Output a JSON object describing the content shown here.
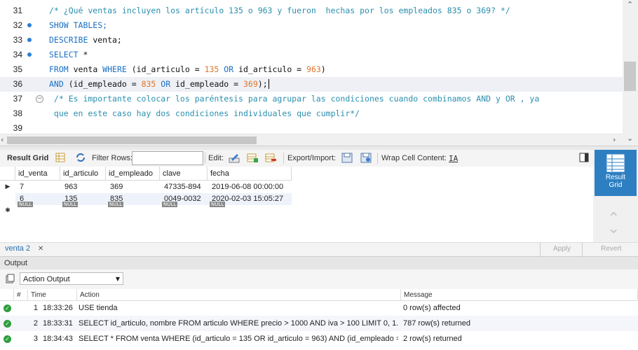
{
  "editor": {
    "lines": [
      {
        "num": "31",
        "dot": false,
        "fold": false,
        "active": false,
        "tokens": [
          {
            "t": "/* ¿Qué ventas incluyen los artículo 135 o 963 y fueron  hechas por los empleados 835 o 369? */",
            "c": "cm"
          }
        ]
      },
      {
        "num": "32",
        "dot": true,
        "fold": false,
        "active": false,
        "tokens": [
          {
            "t": "SHOW TABLES;",
            "c": "kw"
          }
        ]
      },
      {
        "num": "33",
        "dot": true,
        "fold": false,
        "active": false,
        "tokens": [
          {
            "t": "DESCRIBE",
            "c": "kw"
          },
          {
            "t": " venta;",
            "c": "txt"
          }
        ]
      },
      {
        "num": "34",
        "dot": true,
        "fold": false,
        "active": false,
        "tokens": [
          {
            "t": "SELECT",
            "c": "kw"
          },
          {
            "t": " *",
            "c": "txt"
          }
        ]
      },
      {
        "num": "35",
        "dot": false,
        "fold": false,
        "active": false,
        "tokens": [
          {
            "t": "FROM",
            "c": "kw"
          },
          {
            "t": " venta ",
            "c": "txt"
          },
          {
            "t": "WHERE",
            "c": "kw"
          },
          {
            "t": " (id_articulo = ",
            "c": "txt"
          },
          {
            "t": "135",
            "c": "num"
          },
          {
            "t": " ",
            "c": "txt"
          },
          {
            "t": "OR",
            "c": "kw"
          },
          {
            "t": " id_articulo = ",
            "c": "txt"
          },
          {
            "t": "963",
            "c": "num"
          },
          {
            "t": ")",
            "c": "txt"
          }
        ]
      },
      {
        "num": "36",
        "dot": false,
        "fold": false,
        "active": true,
        "tokens": [
          {
            "t": "AND",
            "c": "kw"
          },
          {
            "t": " (id_empleado = ",
            "c": "txt"
          },
          {
            "t": "835",
            "c": "num"
          },
          {
            "t": " ",
            "c": "txt"
          },
          {
            "t": "OR",
            "c": "kw"
          },
          {
            "t": " id_empleado = ",
            "c": "txt"
          },
          {
            "t": "369",
            "c": "num"
          },
          {
            "t": ");",
            "c": "txt"
          }
        ]
      },
      {
        "num": "37",
        "dot": false,
        "fold": true,
        "active": false,
        "tokens": [
          {
            "t": " /* Es importante colocar los paréntesis para agrupar las condiciones cuando combinamos AND y OR , ya",
            "c": "cm"
          }
        ]
      },
      {
        "num": "38",
        "dot": false,
        "fold": false,
        "active": false,
        "tokens": [
          {
            "t": " que en este caso hay dos condiciones individuales que cumplir*/",
            "c": "cm"
          }
        ]
      },
      {
        "num": "39",
        "dot": false,
        "fold": false,
        "active": false,
        "tokens": []
      }
    ]
  },
  "toolbar": {
    "result_grid": "Result Grid",
    "filter_rows": "Filter Rows:",
    "edit": "Edit:",
    "export_import": "Export/Import:",
    "wrap": "Wrap Cell Content:",
    "wrap_icon": "IA"
  },
  "grid": {
    "columns": [
      "id_venta",
      "id_articulo",
      "id_empleado",
      "clave",
      "fecha"
    ],
    "rows": [
      [
        "7",
        "963",
        "369",
        "47335-894",
        "2019-06-08 00:00:00"
      ],
      [
        "6",
        "135",
        "835",
        "0049-0032",
        "2020-02-03 15:05:27"
      ]
    ],
    "null_label": "NULL",
    "row_marker": "▶",
    "new_row_marker": "✱"
  },
  "side": {
    "result_grid_l1": "Result",
    "result_grid_l2": "Grid"
  },
  "tabs": {
    "active": "venta 2",
    "close": "✕",
    "apply": "Apply",
    "revert": "Revert"
  },
  "output": {
    "title": "Output",
    "selector": "Action Output",
    "columns": [
      "#",
      "Time",
      "Action",
      "Message"
    ],
    "rows": [
      {
        "n": "1",
        "time": "18:33:26",
        "action": "USE tienda",
        "message": "0 row(s) affected"
      },
      {
        "n": "2",
        "time": "18:33:31",
        "action": "SELECT id_articulo, nombre FROM articulo WHERE precio > 1000 AND iva > 100 LIMIT 0, 1...",
        "message": "787 row(s) returned"
      },
      {
        "n": "3",
        "time": "18:34:43",
        "action": "SELECT * FROM venta WHERE (id_articulo = 135 OR id_articulo = 963) AND (id_empleado =...",
        "message": "2 row(s) returned"
      }
    ]
  },
  "colors": {
    "keyword": "#1a6fc4",
    "number": "#e0762b",
    "comment": "#2a8fae",
    "accent": "#2d7fc1",
    "success": "#2e9e3e"
  }
}
